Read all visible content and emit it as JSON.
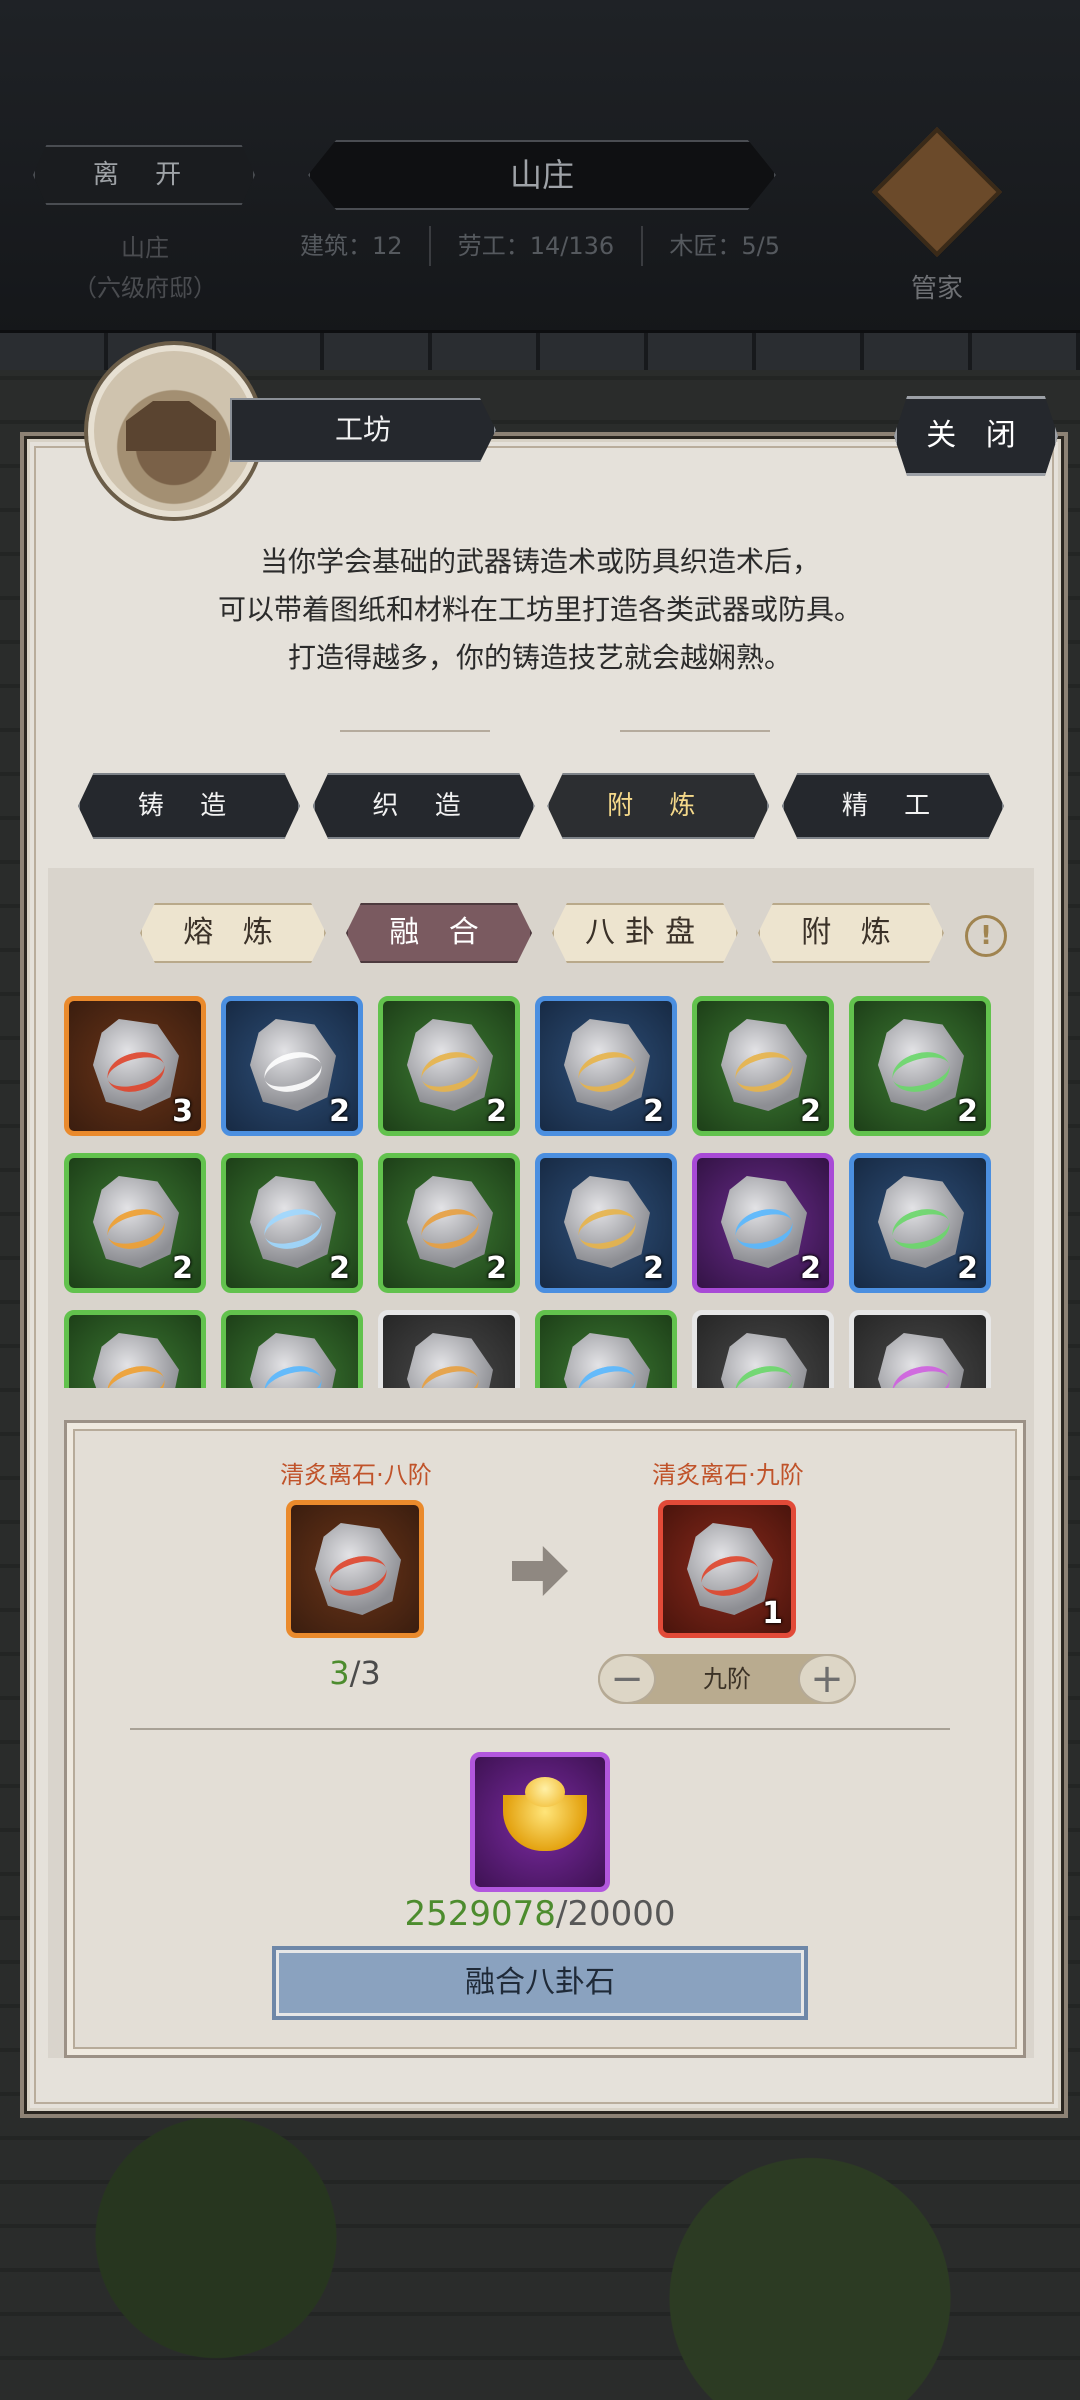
{
  "topbar": {
    "leave_label": "离 开",
    "title": "山庄",
    "location_name": "山庄",
    "location_level": "（六级府邸）",
    "stats": [
      "建筑：12",
      "劳工：14/136",
      "木匠：5/5"
    ],
    "steward_label": "管家"
  },
  "panel": {
    "header": "工坊",
    "close_label": "关 闭",
    "description": [
      "当你学会基础的武器铸造术或防具织造术后，",
      "可以带着图纸和材料在工坊里打造各类武器或防具。",
      "打造得越多，你的铸造技艺就会越娴熟。"
    ],
    "main_tabs": [
      "铸 造",
      "织 造",
      "附 炼",
      "精 工"
    ],
    "active_main_tab": 2,
    "sub_tabs": [
      "熔 炼",
      "融 合",
      "八卦盘",
      "附 炼"
    ],
    "active_sub_tab": 1,
    "info_icon": "!"
  },
  "items": [
    {
      "rarity": "orange",
      "glyph": "#e0452c",
      "count": "3"
    },
    {
      "rarity": "blue",
      "glyph": "#ffffff",
      "count": "2"
    },
    {
      "rarity": "green",
      "glyph": "#e8b44a",
      "count": "2"
    },
    {
      "rarity": "blue",
      "glyph": "#e8b44a",
      "count": "2"
    },
    {
      "rarity": "green",
      "glyph": "#e8b44a",
      "count": "2"
    },
    {
      "rarity": "green",
      "glyph": "#6ad86a",
      "count": "2"
    },
    {
      "rarity": "green",
      "glyph": "#f0a030",
      "count": "2"
    },
    {
      "rarity": "green",
      "glyph": "#9fd8ff",
      "count": "2"
    },
    {
      "rarity": "green",
      "glyph": "#e8a040",
      "count": "2"
    },
    {
      "rarity": "blue",
      "glyph": "#e8b44a",
      "count": "2"
    },
    {
      "rarity": "purple",
      "glyph": "#58b8ff",
      "count": "2"
    },
    {
      "rarity": "blue",
      "glyph": "#6ad86a",
      "count": "2"
    },
    {
      "rarity": "green",
      "glyph": "#f0a030",
      "count": ""
    },
    {
      "rarity": "green",
      "glyph": "#58b8ff",
      "count": ""
    },
    {
      "rarity": "gray",
      "glyph": "#e8a040",
      "count": ""
    },
    {
      "rarity": "green",
      "glyph": "#58b8ff",
      "count": ""
    },
    {
      "rarity": "gray",
      "glyph": "#6ad86a",
      "count": ""
    },
    {
      "rarity": "gray",
      "glyph": "#d060e0",
      "count": ""
    }
  ],
  "fusion": {
    "source_name": "清炙离石·八阶",
    "target_name": "清炙离石·九阶",
    "target_count": "1",
    "source_have": "3",
    "source_need": "/3",
    "tier_value": "九阶",
    "cost_have": "2529078",
    "cost_need": "/20000",
    "fuse_label": "融合八卦石"
  }
}
